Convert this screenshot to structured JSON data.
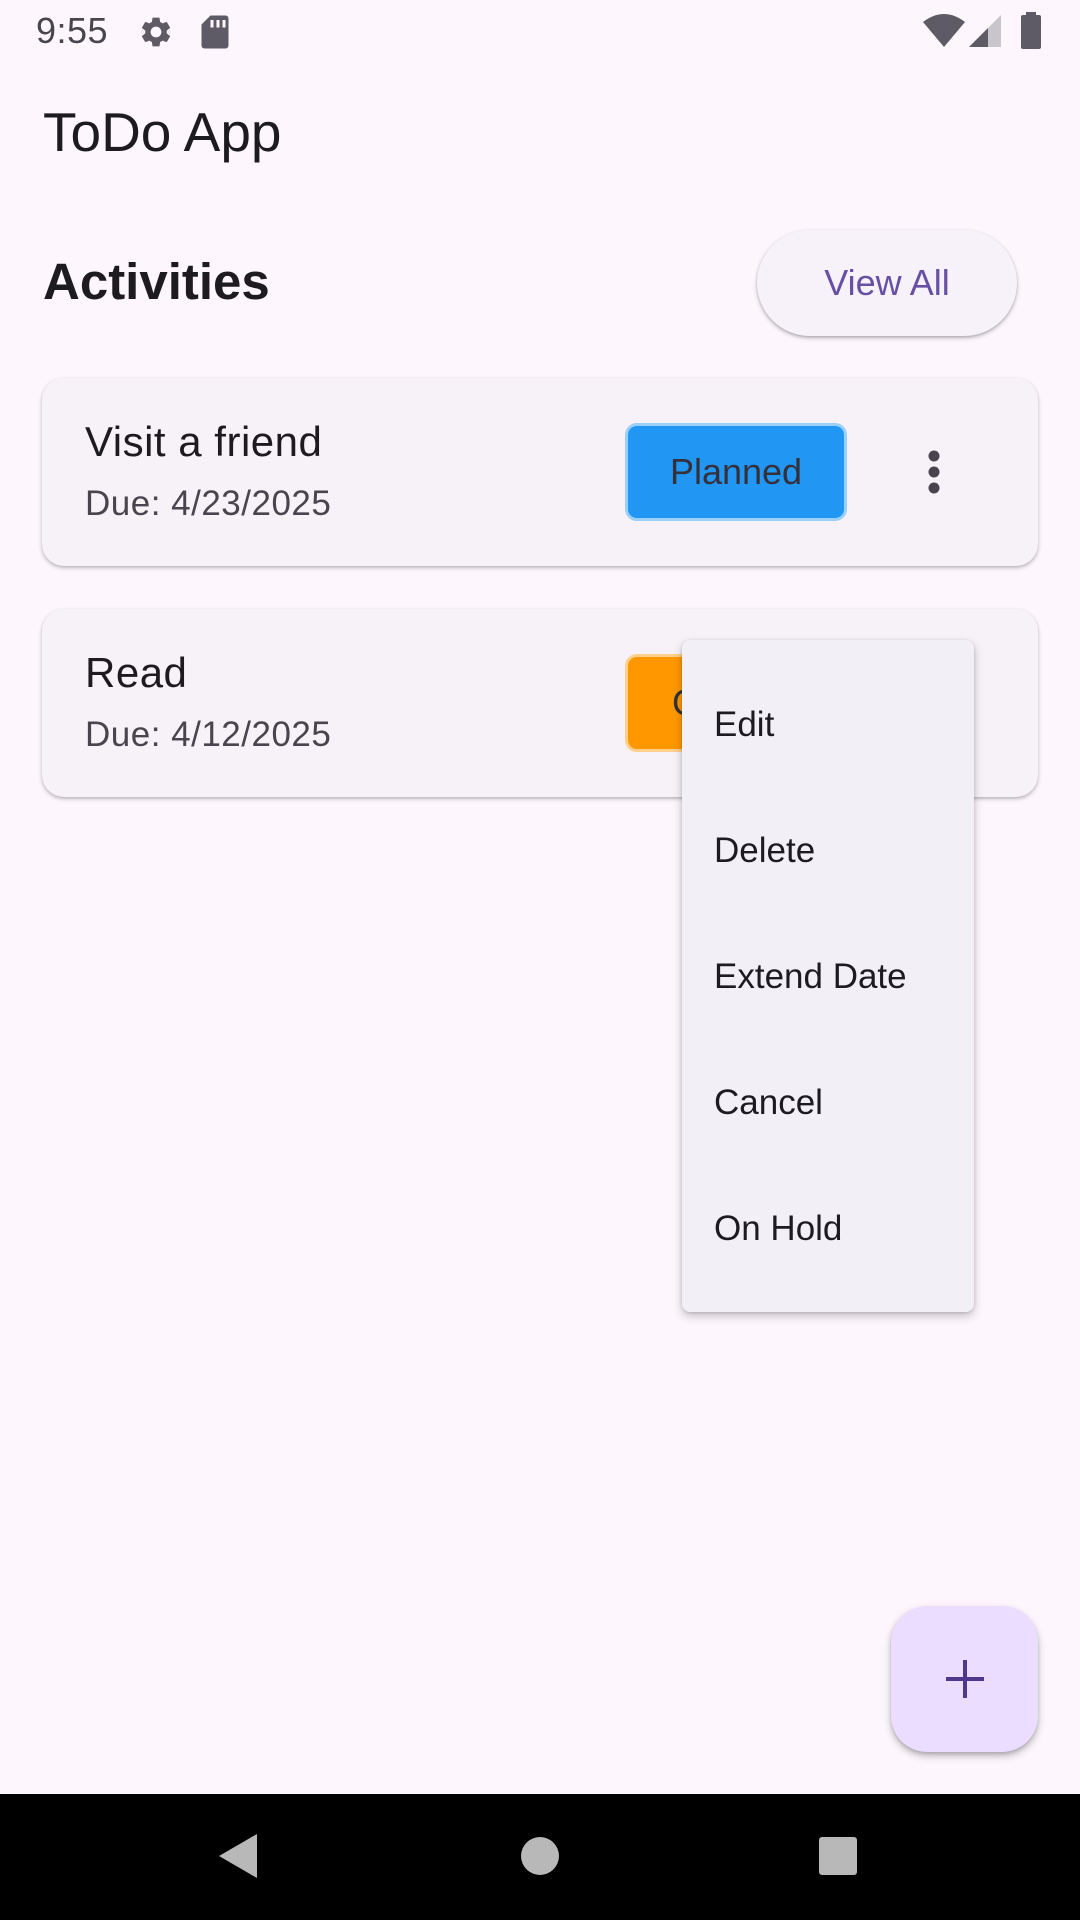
{
  "status_bar": {
    "time": "9:55",
    "icons": [
      "gear-icon",
      "sd-card-icon",
      "wifi-icon",
      "signal-icon",
      "battery-icon"
    ]
  },
  "app_bar": {
    "title": "ToDo App"
  },
  "section": {
    "title": "Activities",
    "view_all_label": "View All"
  },
  "activities": [
    {
      "title": "Visit a friend",
      "due": "Due: 4/23/2025",
      "status": "Planned",
      "status_color": "#2196f3"
    },
    {
      "title": "Read",
      "due": "Due: 4/12/2025",
      "status_visible": "C",
      "status_color": "#ff9800"
    }
  ],
  "menu": {
    "items": [
      "Edit",
      "Delete",
      "Extend Date",
      "Cancel",
      "On Hold"
    ]
  },
  "fab": {
    "icon": "plus-icon"
  },
  "colors": {
    "background": "#fdf7fd",
    "primary": "#6750a4",
    "fab": "#eaddff"
  }
}
